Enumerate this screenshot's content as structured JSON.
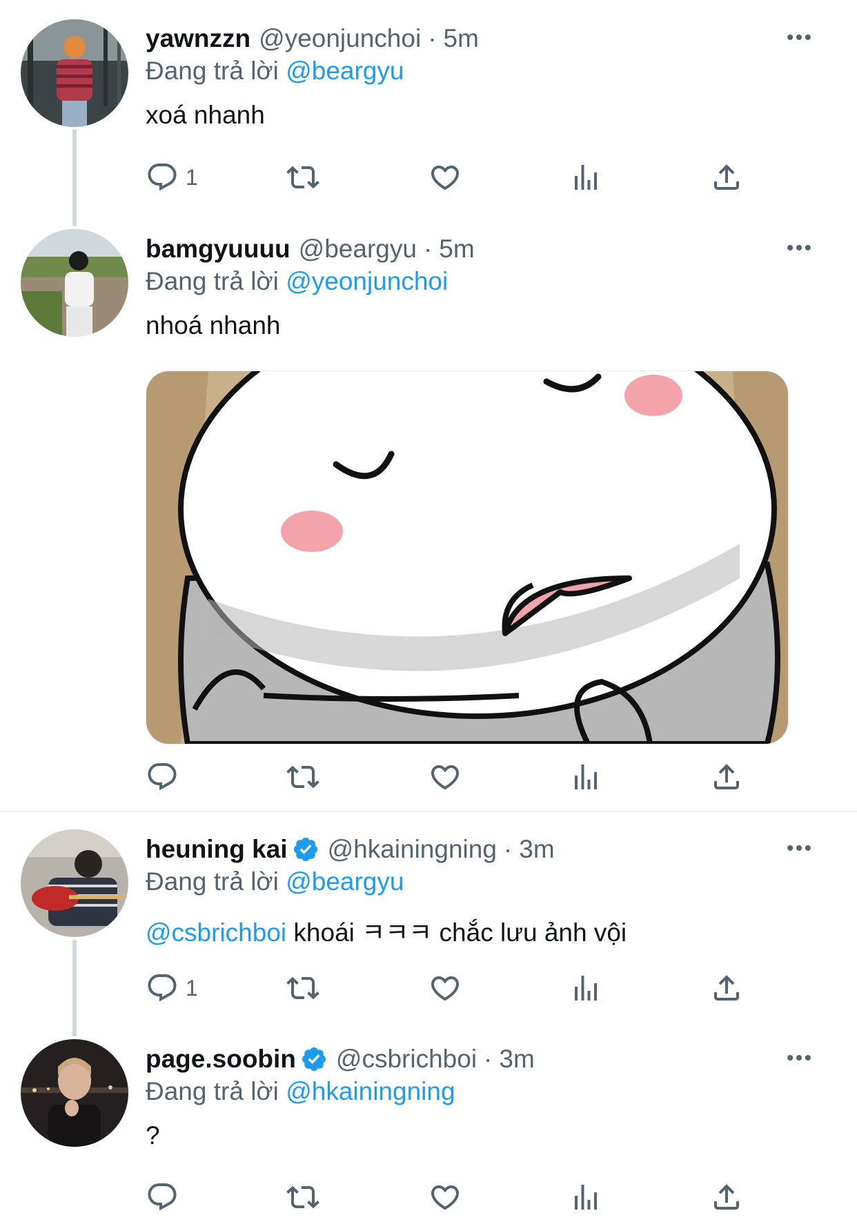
{
  "colors": {
    "accent": "#1d9bf0",
    "text": "#0f1419",
    "secondary": "#536471",
    "thread_line": "#cfd9de"
  },
  "tweets": [
    {
      "display_name": "yawnzzn",
      "handle": "@yeonjunchoi",
      "separator": "·",
      "time": "5m",
      "verified": false,
      "replying_prefix": "Đang trả lời",
      "replying_to": "@beargyu",
      "text": "xoá nhanh",
      "reply_count": "1",
      "avatar_icon": "avatar-photo"
    },
    {
      "display_name": "bamgyuuuu",
      "handle": "@beargyu",
      "separator": "·",
      "time": "5m",
      "verified": false,
      "replying_prefix": "Đang trả lời",
      "replying_to": "@yeonjunchoi",
      "text": "nhoá nhanh",
      "reply_count": "",
      "avatar_icon": "avatar-photo",
      "media": "cartoon-sleepy-face-image"
    },
    {
      "display_name": "heuning kai",
      "handle": "@hkainingning",
      "separator": "·",
      "time": "3m",
      "verified": true,
      "replying_prefix": "Đang trả lời",
      "replying_to": "@beargyu",
      "text_mention": "@csbrichboi",
      "text": "khoái ㅋㅋㅋ chắc lưu ảnh vội",
      "reply_count": "1",
      "avatar_icon": "avatar-photo"
    },
    {
      "display_name": "page.soobin",
      "handle": "@csbrichboi",
      "separator": "·",
      "time": "3m",
      "verified": true,
      "replying_prefix": "Đang trả lời",
      "replying_to": "@hkainingning",
      "text": "?",
      "reply_count": "",
      "avatar_icon": "avatar-photo"
    }
  ],
  "icons": {
    "reply": "reply-icon",
    "retweet": "retweet-icon",
    "like": "heart-icon",
    "views": "views-icon",
    "share": "share-icon",
    "more": "more-icon",
    "verified": "verified-badge-icon"
  }
}
